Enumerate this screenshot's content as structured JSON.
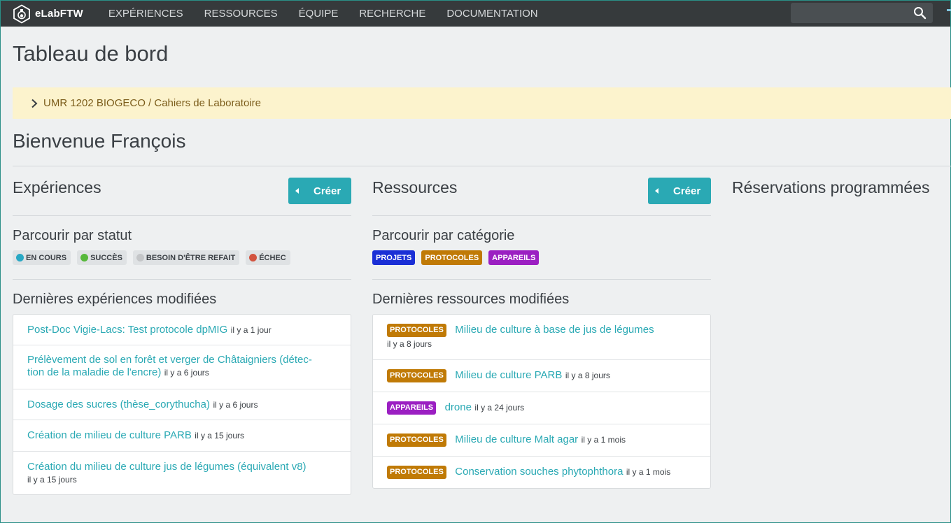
{
  "nav": {
    "brand": "eLabFTW",
    "links": [
      "EXPÉRIENCES",
      "RESSOURCES",
      "ÉQUIPE",
      "RECHERCHE",
      "DOCUMENTATION"
    ],
    "search_placeholder": ""
  },
  "page_title": "Tableau de bord",
  "team_banner": "UMR 1202 BIOGECO / Cahiers de Laboratoire",
  "welcome": "Bienvenue François",
  "experiments": {
    "title": "Expériences",
    "create_label": "Créer",
    "browse_title": "Parcourir par statut",
    "statuses": [
      {
        "label": "EN COURS",
        "color": "#29a8c4"
      },
      {
        "label": "SUCCÈS",
        "color": "#56b83a"
      },
      {
        "label": "BESOIN D'ÊTRE REFAIT",
        "color": "#c4c6c8"
      },
      {
        "label": "ÉCHEC",
        "color": "#d2533f"
      }
    ],
    "recent_title": "Dernières expériences modifiées",
    "recent": [
      {
        "title": "Post-Doc Vigie-Lacs: Test protocole dpMIG",
        "time": "il y a 1 jour"
      },
      {
        "title_line1": "Prélèvement de sol en forêt et verger de Châtaigniers (détec-",
        "title_line2": "tion de la maladie de l'encre)",
        "time": "il y a 6 jours"
      },
      {
        "title": "Dosage des sucres (thèse_corythucha)",
        "time": "il y a 6 jours"
      },
      {
        "title": "Création de milieu de culture PARB",
        "time": "il y a 15 jours"
      },
      {
        "title": "Création du milieu de culture jus de légumes (équivalent v8)",
        "time": "il y a 15 jours"
      }
    ]
  },
  "resources": {
    "title": "Ressources",
    "create_label": "Créer",
    "browse_title": "Parcourir par catégorie",
    "categories": [
      {
        "label": "PROJETS",
        "color": "#1a2fd6"
      },
      {
        "label": "PROTOCOLES",
        "color": "#c07a06"
      },
      {
        "label": "APPAREILS",
        "color": "#9b1fc2"
      }
    ],
    "recent_title": "Dernières ressources modifiées",
    "recent": [
      {
        "tag": "PROTOCOLES",
        "tag_color": "#c07a06",
        "title": "Milieu de culture à base de jus de légumes",
        "time": "il y a 8 jours"
      },
      {
        "tag": "PROTOCOLES",
        "tag_color": "#c07a06",
        "title": "Milieu de culture PARB",
        "time": "il y a 8 jours"
      },
      {
        "tag": "APPAREILS",
        "tag_color": "#9b1fc2",
        "title": "drone",
        "time": "il y a 24 jours"
      },
      {
        "tag": "PROTOCOLES",
        "tag_color": "#c07a06",
        "title": "Milieu de culture Malt agar",
        "time": "il y a 1 mois"
      },
      {
        "tag": "PROTOCOLES",
        "tag_color": "#c07a06",
        "title": "Conservation souches phytophthora",
        "time": "il y a 1 mois"
      }
    ]
  },
  "bookings": {
    "title": "Réservations programmées"
  }
}
